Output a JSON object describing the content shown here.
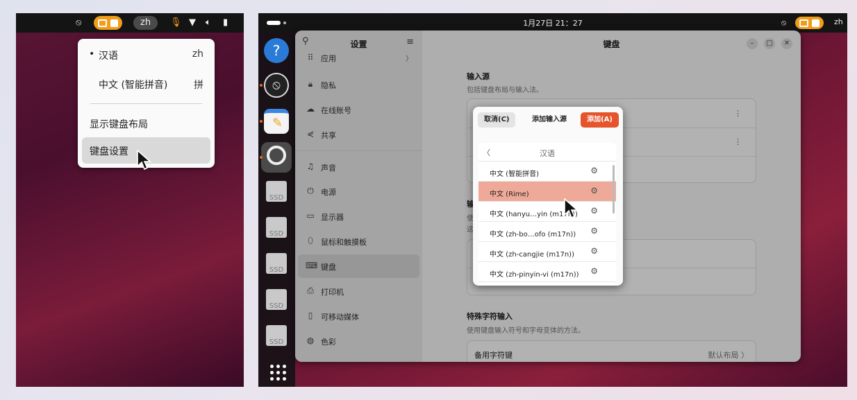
{
  "left": {
    "tray": {
      "ime_label": "zh"
    },
    "menu": {
      "items": [
        {
          "label": "汉语",
          "short": "zh",
          "bullet": "•"
        },
        {
          "label": "中文 (智能拼音)",
          "short": "拼"
        }
      ],
      "show_layout": "显示键盘布局",
      "keyboard_settings": "键盘设置"
    }
  },
  "right": {
    "topbar": {
      "clock": "1月27日 21：27",
      "ime_label": "zh"
    },
    "dock": {
      "ssd_label": "SSD"
    },
    "settings": {
      "sidebar_title": "设置",
      "window_title": "键盘",
      "sidebar_items": [
        {
          "icon": "apps-icon",
          "glyph": "⠿",
          "label": "应用",
          "chevron": "〉"
        },
        {
          "icon": "lock-icon",
          "glyph": "🔒︎",
          "label": "隐私"
        },
        {
          "icon": "cloud-icon",
          "glyph": "☁",
          "label": "在线账号"
        },
        {
          "icon": "share-icon",
          "glyph": "⋞",
          "label": "共享"
        },
        {
          "icon": "music-icon",
          "glyph": "♫",
          "label": "声音"
        },
        {
          "icon": "power-icon",
          "glyph": "⏻",
          "label": "电源"
        },
        {
          "icon": "display-icon",
          "glyph": "▭",
          "label": "显示器"
        },
        {
          "icon": "mouse-icon",
          "glyph": "⬯",
          "label": "鼠标和触摸板"
        },
        {
          "icon": "keyboard-icon",
          "glyph": "⌨",
          "label": "键盘"
        },
        {
          "icon": "printer-icon",
          "glyph": "⎙",
          "label": "打印机"
        },
        {
          "icon": "removable-media-icon",
          "glyph": "▯",
          "label": "可移动媒体"
        },
        {
          "icon": "color-icon",
          "glyph": "◍",
          "label": "色彩"
        }
      ],
      "input_sources": {
        "title": "输入源",
        "subtitle": "包括键盘布局与输入法。"
      },
      "partial_section": {
        "title_char": "输",
        "sub_char1": "使",
        "sub_char2": "这"
      },
      "special_chars": {
        "title": "特殊字符输入",
        "subtitle": "使用键盘输入符号和字母变体的方法。",
        "alt_key_label": "备用字符键",
        "alt_key_value": "默认布局 〉"
      }
    },
    "dialog": {
      "cancel": "取消(C)",
      "title": "添加输入源",
      "add": "添加(A)",
      "back_glyph": "〈",
      "language": "汉语",
      "options": [
        "中文 (智能拼音)",
        "中文 (Rime)",
        "中文 (hanyu…yin (m17n))",
        "中文 (zh-bo…ofo (m17n))",
        "中文 (zh-cangjie (m17n))",
        "中文 (zh-pinyin-vi (m17n))"
      ],
      "selected_index": 1
    }
  }
}
